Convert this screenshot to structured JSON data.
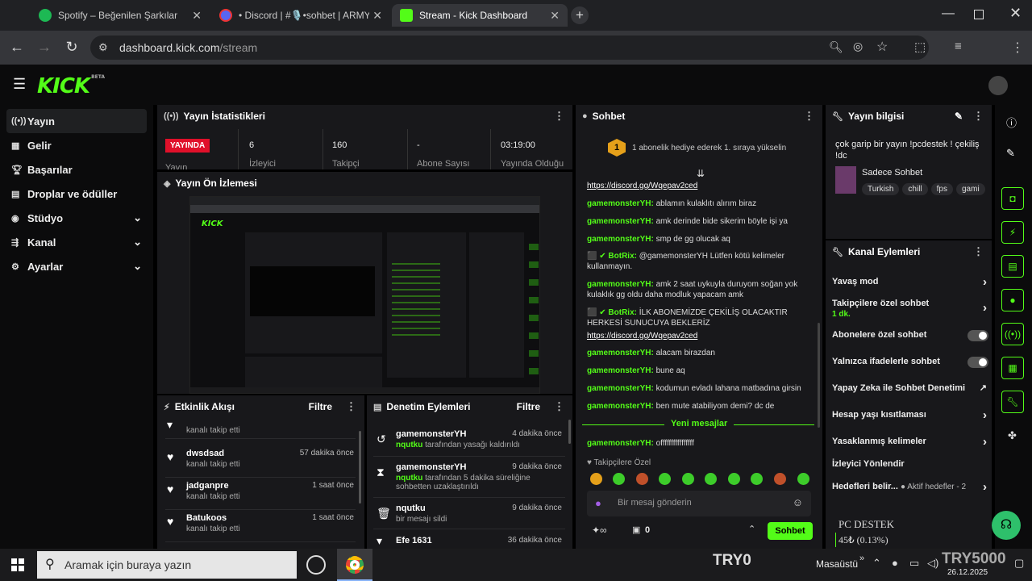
{
  "browser": {
    "tabs": [
      {
        "title": "Spotify – Beğenilen Şarkılar"
      },
      {
        "title": "• Discord | #🎙️•sohbet | ARMY"
      },
      {
        "title": "Stream - Kick Dashboard"
      }
    ],
    "url_host": "dashboard.kick.com",
    "url_path": "/stream"
  },
  "kick": {
    "logo": "KICK",
    "logo_sup": "BETA"
  },
  "sidebar": {
    "items": [
      {
        "label": "Yayın",
        "icon": "broadcast-icon"
      },
      {
        "label": "Gelir",
        "icon": "revenue-icon"
      },
      {
        "label": "Başarılar",
        "icon": "trophy-icon"
      },
      {
        "label": "Droplar ve ödüller",
        "icon": "gift-icon"
      },
      {
        "label": "Stüdyo",
        "icon": "studio-icon"
      },
      {
        "label": "Kanal",
        "icon": "channel-icon"
      },
      {
        "label": "Ayarlar",
        "icon": "gear-icon"
      }
    ]
  },
  "stats": {
    "title": "Yayın İstatistikleri",
    "live_badge": "YAYINDA",
    "live_label": "Yayın",
    "items": [
      {
        "value": "6",
        "label": "İzleyici"
      },
      {
        "value": "160",
        "label": "Takipçi"
      },
      {
        "value": "-",
        "label": "Abone Sayısı"
      },
      {
        "value": "03:19:00",
        "label": "Yayında Olduğu"
      }
    ]
  },
  "preview": {
    "title": "Yayın Ön İzlemesi"
  },
  "activity": {
    "title": "Etkinlik Akışı",
    "filter": "Filtre",
    "rows": [
      {
        "name": "",
        "sub": "kanalı takip etti",
        "time": ""
      },
      {
        "name": "dwsdsad",
        "sub": "kanalı takip etti",
        "time": "57 dakika önce"
      },
      {
        "name": "jadganpre",
        "sub": "kanalı takip etti",
        "time": "1 saat önce"
      },
      {
        "name": "Batukoos",
        "sub": "kanalı takip etti",
        "time": "1 saat önce"
      }
    ]
  },
  "moderation": {
    "title": "Denetim Eylemleri",
    "filter": "Filtre",
    "rows": [
      {
        "name": "gamemonsterYH",
        "actor": "nqutku",
        "sub": " tarafından yasağı kaldırıldı",
        "time": "4 dakika önce",
        "icon": "undo-icon"
      },
      {
        "name": "gamemonsterYH",
        "actor": "nqutku",
        "sub": " tarafından 5 dakika süreliğine sohbetten uzaklaştırıldı",
        "time": "9 dakika önce",
        "icon": "hourglass-icon"
      },
      {
        "name": "nqutku",
        "actor": "",
        "sub": "bir mesajı sildi",
        "time": "9 dakika önce",
        "icon": "trash-icon"
      },
      {
        "name": "Efe 1631",
        "actor": "",
        "sub": "",
        "time": "36 dakika önce",
        "icon": "chevron-down-icon"
      }
    ]
  },
  "chat": {
    "title": "Sohbet",
    "gift_banner": "1 abonelik hediye ederek 1. sıraya yükselin",
    "gift_rank": "1",
    "messages": [
      {
        "user": "",
        "text": "https://discord.gg/Wqepav2ced",
        "link": true
      },
      {
        "user": "gamemonsterYH:",
        "text": " ablamın kulaklıtı alırım biraz"
      },
      {
        "user": "gamemonsterYH:",
        "text": " amk derinde bide sikerim böyle işi ya"
      },
      {
        "user": "gamemonsterYH:",
        "text": " smp de gg olucak aq"
      },
      {
        "user": "BotRix:",
        "text": " @gamemonsterYH Lütfen kötü kelimeler kullanmayın.",
        "bot": true
      },
      {
        "user": "gamemonsterYH:",
        "text": " amk 2 saat uykuyla duruyom soğan yok kulaklık gg oldu daha modluk yapacam amk"
      },
      {
        "user": "BotRix:",
        "text": " İLK ABONEMİZDE ÇEKİLİŞ OLACAKTIR HERKESİ SUNUCUYA BEKLERİZ",
        "bot": true
      },
      {
        "user": "",
        "text": "https://discord.gg/Wqepav2ced",
        "link": true
      },
      {
        "user": "gamemonsterYH:",
        "text": " alacam birazdan"
      },
      {
        "user": "gamemonsterYH:",
        "text": " bune aq"
      },
      {
        "user": "gamemonsterYH:",
        "text": " kodumun evladı lahana matbadına girsin"
      },
      {
        "user": "gamemonsterYH:",
        "text": " ben mute atabiliyom demi? dc de"
      }
    ],
    "new_messages": "Yeni mesajlar",
    "last_message": {
      "user": "gamemonsterYH:",
      "text": " offffffffffffffff"
    },
    "followers_only": "Takipçilere Özel",
    "input_placeholder": "Bir mesaj gönderin",
    "points": "0",
    "send": "Sohbet"
  },
  "stream_info": {
    "title": "Yayın bilgisi",
    "stream_title": "çok garip bir yayın !pcdestek ! çekiliş !dc",
    "category": "Sadece Sohbet",
    "tags": [
      "Turkish",
      "chill",
      "fps",
      "gami"
    ]
  },
  "channel_actions": {
    "title": "Kanal Eylemleri",
    "items": [
      {
        "label": "Yavaş mod",
        "type": "arrow"
      },
      {
        "label": "Takipçilere özel sohbet",
        "sub": "1 dk.",
        "type": "arrow"
      },
      {
        "label": "Abonelere özel sohbet",
        "type": "toggle"
      },
      {
        "label": "Yalnızca ifadelerle sohbet",
        "type": "toggle"
      },
      {
        "label": "Yapay Zeka ile Sohbet Denetimi",
        "type": "external"
      },
      {
        "label": "Hesap yaşı kısıtlaması",
        "type": "arrow"
      },
      {
        "label": "Yasaklanmış kelimeler",
        "type": "arrow"
      },
      {
        "label": "İzleyici Yönlendir",
        "type": "none"
      },
      {
        "label": "Hedefleri belir...",
        "sub": "Aktif hedefler - 2",
        "type": "arrow"
      }
    ]
  },
  "overlay": {
    "pc_destek": "PC DESTEK",
    "progress": "45₺ (0.13%)",
    "try0": "TRY0",
    "try5000": "TRY5000"
  },
  "taskbar": {
    "search_placeholder": "Aramak için buraya yazın",
    "desktop": "Masaüstü",
    "date": "26.12.2025"
  }
}
